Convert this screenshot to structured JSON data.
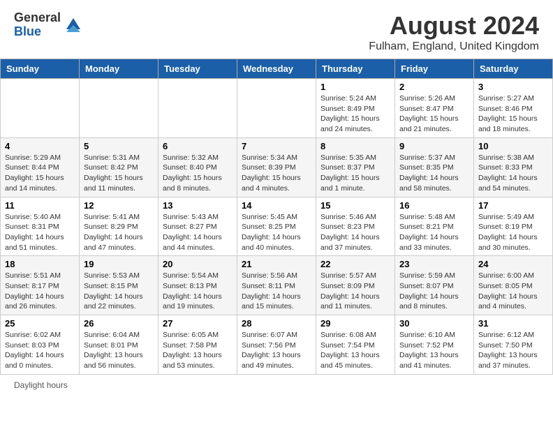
{
  "header": {
    "logo_general": "General",
    "logo_blue": "Blue",
    "main_title": "August 2024",
    "subtitle": "Fulham, England, United Kingdom"
  },
  "calendar": {
    "days_of_week": [
      "Sunday",
      "Monday",
      "Tuesday",
      "Wednesday",
      "Thursday",
      "Friday",
      "Saturday"
    ],
    "weeks": [
      {
        "row": 1,
        "days": [
          {
            "num": "",
            "info": ""
          },
          {
            "num": "",
            "info": ""
          },
          {
            "num": "",
            "info": ""
          },
          {
            "num": "",
            "info": ""
          },
          {
            "num": "1",
            "info": "Sunrise: 5:24 AM\nSunset: 8:49 PM\nDaylight: 15 hours\nand 24 minutes."
          },
          {
            "num": "2",
            "info": "Sunrise: 5:26 AM\nSunset: 8:47 PM\nDaylight: 15 hours\nand 21 minutes."
          },
          {
            "num": "3",
            "info": "Sunrise: 5:27 AM\nSunset: 8:46 PM\nDaylight: 15 hours\nand 18 minutes."
          }
        ]
      },
      {
        "row": 2,
        "days": [
          {
            "num": "4",
            "info": "Sunrise: 5:29 AM\nSunset: 8:44 PM\nDaylight: 15 hours\nand 14 minutes."
          },
          {
            "num": "5",
            "info": "Sunrise: 5:31 AM\nSunset: 8:42 PM\nDaylight: 15 hours\nand 11 minutes."
          },
          {
            "num": "6",
            "info": "Sunrise: 5:32 AM\nSunset: 8:40 PM\nDaylight: 15 hours\nand 8 minutes."
          },
          {
            "num": "7",
            "info": "Sunrise: 5:34 AM\nSunset: 8:39 PM\nDaylight: 15 hours\nand 4 minutes."
          },
          {
            "num": "8",
            "info": "Sunrise: 5:35 AM\nSunset: 8:37 PM\nDaylight: 15 hours\nand 1 minute."
          },
          {
            "num": "9",
            "info": "Sunrise: 5:37 AM\nSunset: 8:35 PM\nDaylight: 14 hours\nand 58 minutes."
          },
          {
            "num": "10",
            "info": "Sunrise: 5:38 AM\nSunset: 8:33 PM\nDaylight: 14 hours\nand 54 minutes."
          }
        ]
      },
      {
        "row": 3,
        "days": [
          {
            "num": "11",
            "info": "Sunrise: 5:40 AM\nSunset: 8:31 PM\nDaylight: 14 hours\nand 51 minutes."
          },
          {
            "num": "12",
            "info": "Sunrise: 5:41 AM\nSunset: 8:29 PM\nDaylight: 14 hours\nand 47 minutes."
          },
          {
            "num": "13",
            "info": "Sunrise: 5:43 AM\nSunset: 8:27 PM\nDaylight: 14 hours\nand 44 minutes."
          },
          {
            "num": "14",
            "info": "Sunrise: 5:45 AM\nSunset: 8:25 PM\nDaylight: 14 hours\nand 40 minutes."
          },
          {
            "num": "15",
            "info": "Sunrise: 5:46 AM\nSunset: 8:23 PM\nDaylight: 14 hours\nand 37 minutes."
          },
          {
            "num": "16",
            "info": "Sunrise: 5:48 AM\nSunset: 8:21 PM\nDaylight: 14 hours\nand 33 minutes."
          },
          {
            "num": "17",
            "info": "Sunrise: 5:49 AM\nSunset: 8:19 PM\nDaylight: 14 hours\nand 30 minutes."
          }
        ]
      },
      {
        "row": 4,
        "days": [
          {
            "num": "18",
            "info": "Sunrise: 5:51 AM\nSunset: 8:17 PM\nDaylight: 14 hours\nand 26 minutes."
          },
          {
            "num": "19",
            "info": "Sunrise: 5:53 AM\nSunset: 8:15 PM\nDaylight: 14 hours\nand 22 minutes."
          },
          {
            "num": "20",
            "info": "Sunrise: 5:54 AM\nSunset: 8:13 PM\nDaylight: 14 hours\nand 19 minutes."
          },
          {
            "num": "21",
            "info": "Sunrise: 5:56 AM\nSunset: 8:11 PM\nDaylight: 14 hours\nand 15 minutes."
          },
          {
            "num": "22",
            "info": "Sunrise: 5:57 AM\nSunset: 8:09 PM\nDaylight: 14 hours\nand 11 minutes."
          },
          {
            "num": "23",
            "info": "Sunrise: 5:59 AM\nSunset: 8:07 PM\nDaylight: 14 hours\nand 8 minutes."
          },
          {
            "num": "24",
            "info": "Sunrise: 6:00 AM\nSunset: 8:05 PM\nDaylight: 14 hours\nand 4 minutes."
          }
        ]
      },
      {
        "row": 5,
        "days": [
          {
            "num": "25",
            "info": "Sunrise: 6:02 AM\nSunset: 8:03 PM\nDaylight: 14 hours\nand 0 minutes."
          },
          {
            "num": "26",
            "info": "Sunrise: 6:04 AM\nSunset: 8:01 PM\nDaylight: 13 hours\nand 56 minutes."
          },
          {
            "num": "27",
            "info": "Sunrise: 6:05 AM\nSunset: 7:58 PM\nDaylight: 13 hours\nand 53 minutes."
          },
          {
            "num": "28",
            "info": "Sunrise: 6:07 AM\nSunset: 7:56 PM\nDaylight: 13 hours\nand 49 minutes."
          },
          {
            "num": "29",
            "info": "Sunrise: 6:08 AM\nSunset: 7:54 PM\nDaylight: 13 hours\nand 45 minutes."
          },
          {
            "num": "30",
            "info": "Sunrise: 6:10 AM\nSunset: 7:52 PM\nDaylight: 13 hours\nand 41 minutes."
          },
          {
            "num": "31",
            "info": "Sunrise: 6:12 AM\nSunset: 7:50 PM\nDaylight: 13 hours\nand 37 minutes."
          }
        ]
      }
    ]
  },
  "footer": {
    "daylight_label": "Daylight hours"
  }
}
